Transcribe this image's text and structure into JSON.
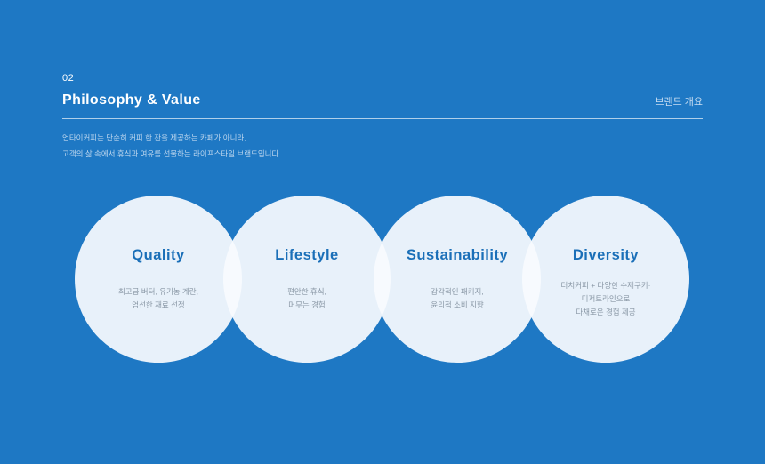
{
  "header": {
    "section_number": "02",
    "title": "Philosophy & Value",
    "category": "브랜드 개요"
  },
  "intro": {
    "lines": [
      "언타이커피는 단순히 커피 한 잔을 제공하는 카페가 아니라,",
      "고객의 삶 속에서 휴식과 여유를 선물하는 라이프스타일 브랜드입니다."
    ]
  },
  "values": [
    {
      "title": "Quality",
      "lines": [
        "최고급 버터, 유기농 계란,",
        "엄선한 재료 선정"
      ]
    },
    {
      "title": "Lifestyle",
      "lines": [
        "편안한 휴식,",
        "머무는 경험"
      ]
    },
    {
      "title": "Sustainability",
      "lines": [
        "감각적인 패키지,",
        "윤리적 소비 지향"
      ]
    },
    {
      "title": "Diversity",
      "lines": [
        "더치커피 + 다양한 수제쿠키·",
        "디저트라인으로",
        "다채로운 경험 제공"
      ]
    }
  ],
  "colors": {
    "background": "#1e78c4",
    "accent": "#1a6fb8",
    "circle_fill": "#f8fbfe"
  }
}
